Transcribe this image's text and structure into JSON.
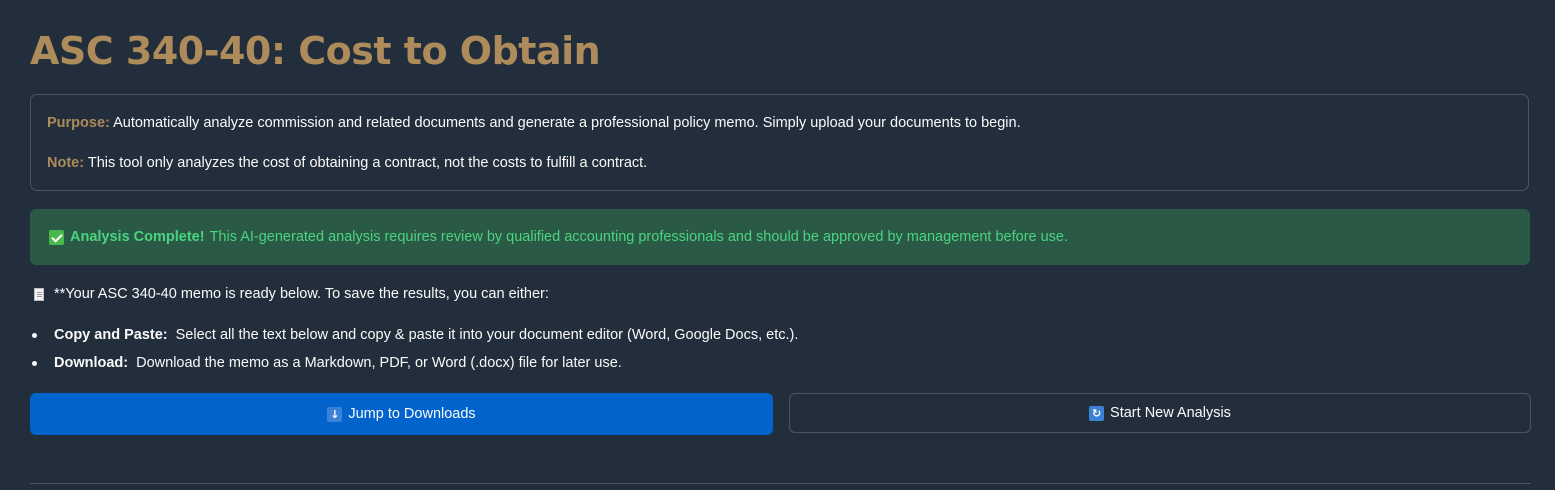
{
  "header": {
    "title": "ASC 340-40: Cost to Obtain"
  },
  "info": {
    "purpose_label": "Purpose:",
    "purpose_text": "Automatically analyze commission and related documents and generate a professional policy memo. Simply upload your documents to begin.",
    "note_label": "Note:",
    "note_text": "This tool only analyzes the cost of obtaining a contract, not the costs to fulfill a contract."
  },
  "status": {
    "icon": "check-mark-icon",
    "title": "Analysis Complete!",
    "message": "This AI-generated analysis requires review by qualified accounting professionals and should be approved by management before use.",
    "color": "#4bd37f",
    "background": "#2a5a46"
  },
  "memo": {
    "icon": "document-icon",
    "intro": "**Your ASC 340-40 memo is ready below. To save the results, you can either:",
    "options": [
      {
        "label": "Copy and Paste:",
        "text": "Select all the text below and copy & paste it into your document editor (Word, Google Docs, etc.)."
      },
      {
        "label": "Download:",
        "text": "Download the memo as a Markdown, PDF, or Word (.docx) file for later use."
      }
    ]
  },
  "actions": {
    "jump_icon": "down-arrow-icon",
    "jump_label": "Jump to Downloads",
    "new_icon": "refresh-icon",
    "new_label": "Start New Analysis"
  },
  "colors": {
    "background": "#222e3c",
    "accent": "#ad8b5a",
    "primary_button": "#0263cc"
  }
}
